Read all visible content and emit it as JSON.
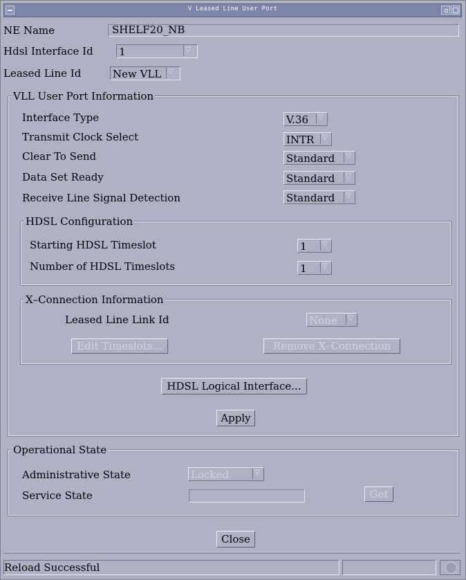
{
  "window": {
    "title": "V Leased Line User Port"
  },
  "ne": {
    "label": "NE Name",
    "value": "SHELF20_NB"
  },
  "hdsl_interface": {
    "label": "Hdsl Interface Id",
    "value": "1"
  },
  "leased_line": {
    "label": "Leased Line Id",
    "value": "New VLL"
  },
  "vll": {
    "legend": "VLL User Port Information",
    "interface_type": {
      "label": "Interface Type",
      "value": "V.36"
    },
    "transmit_clock": {
      "label": "Transmit Clock Select",
      "value": "INTR"
    },
    "clear_to_send": {
      "label": "Clear To Send",
      "value": "Standard"
    },
    "data_set_ready": {
      "label": "Data Set Ready",
      "value": "Standard"
    },
    "receive_line_signal": {
      "label": "Receive Line Signal Detection",
      "value": "Standard"
    },
    "hdsl_config": {
      "legend": "HDSL Configuration",
      "starting_timeslot": {
        "label": "Starting HDSL Timeslot",
        "value": "1"
      },
      "num_timeslots": {
        "label": "Number of HDSL Timeslots",
        "value": "1"
      }
    },
    "xconn": {
      "legend": "X–Connection Information",
      "link_id": {
        "label": "Leased Line Link Id",
        "value": "None"
      },
      "edit_timeslots": "Edit Timeslots...",
      "remove_xconn": "Remove X–Connection"
    },
    "hdsl_logical": "HDSL Logical Interface...",
    "apply": "Apply"
  },
  "operational": {
    "legend": "Operational State",
    "admin_state": {
      "label": "Administrative State",
      "value": "Locked"
    },
    "service_state": {
      "label": "Service State",
      "value": ""
    },
    "get": "Get"
  },
  "close": "Close",
  "status": {
    "message": "Reload Successful"
  }
}
